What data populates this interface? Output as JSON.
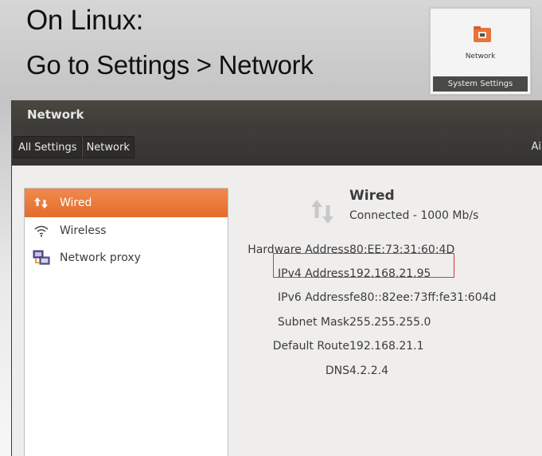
{
  "headline": {
    "line1": "On Linux:",
    "line2": "Go to Settings > Network"
  },
  "launcher": {
    "label": "Network",
    "footer": "System Settings",
    "icon": "network-folder-icon"
  },
  "window": {
    "title": "Network",
    "breadcrumbs": [
      "All Settings",
      "Network"
    ],
    "toolbar_right_text": "Ai"
  },
  "sidebar": {
    "items": [
      {
        "label": "Wired",
        "icon": "wired-arrows-icon",
        "selected": true
      },
      {
        "label": "Wireless",
        "icon": "wifi-icon",
        "selected": false
      },
      {
        "label": "Network proxy",
        "icon": "network-proxy-icon",
        "selected": false
      }
    ]
  },
  "detail": {
    "title": "Wired",
    "status": "Connected - 1000 Mb/s",
    "rows": [
      {
        "label": "Hardware Address",
        "value": "80:EE:73:31:60:4D"
      },
      {
        "label": "IPv4 Address",
        "value": "192.168.21.95",
        "highlighted": true
      },
      {
        "label": "IPv6 Address",
        "value": "fe80::82ee:73ff:fe31:604d"
      },
      {
        "label": "Subnet Mask",
        "value": "255.255.255.0"
      },
      {
        "label": "Default Route",
        "value": "192.168.21.1"
      },
      {
        "label": "DNS",
        "value": "4.2.2.4"
      }
    ]
  },
  "colors": {
    "accent": "#e8743a",
    "highlight_box": "#d63a3a",
    "titlebar": "#3c3b37"
  }
}
